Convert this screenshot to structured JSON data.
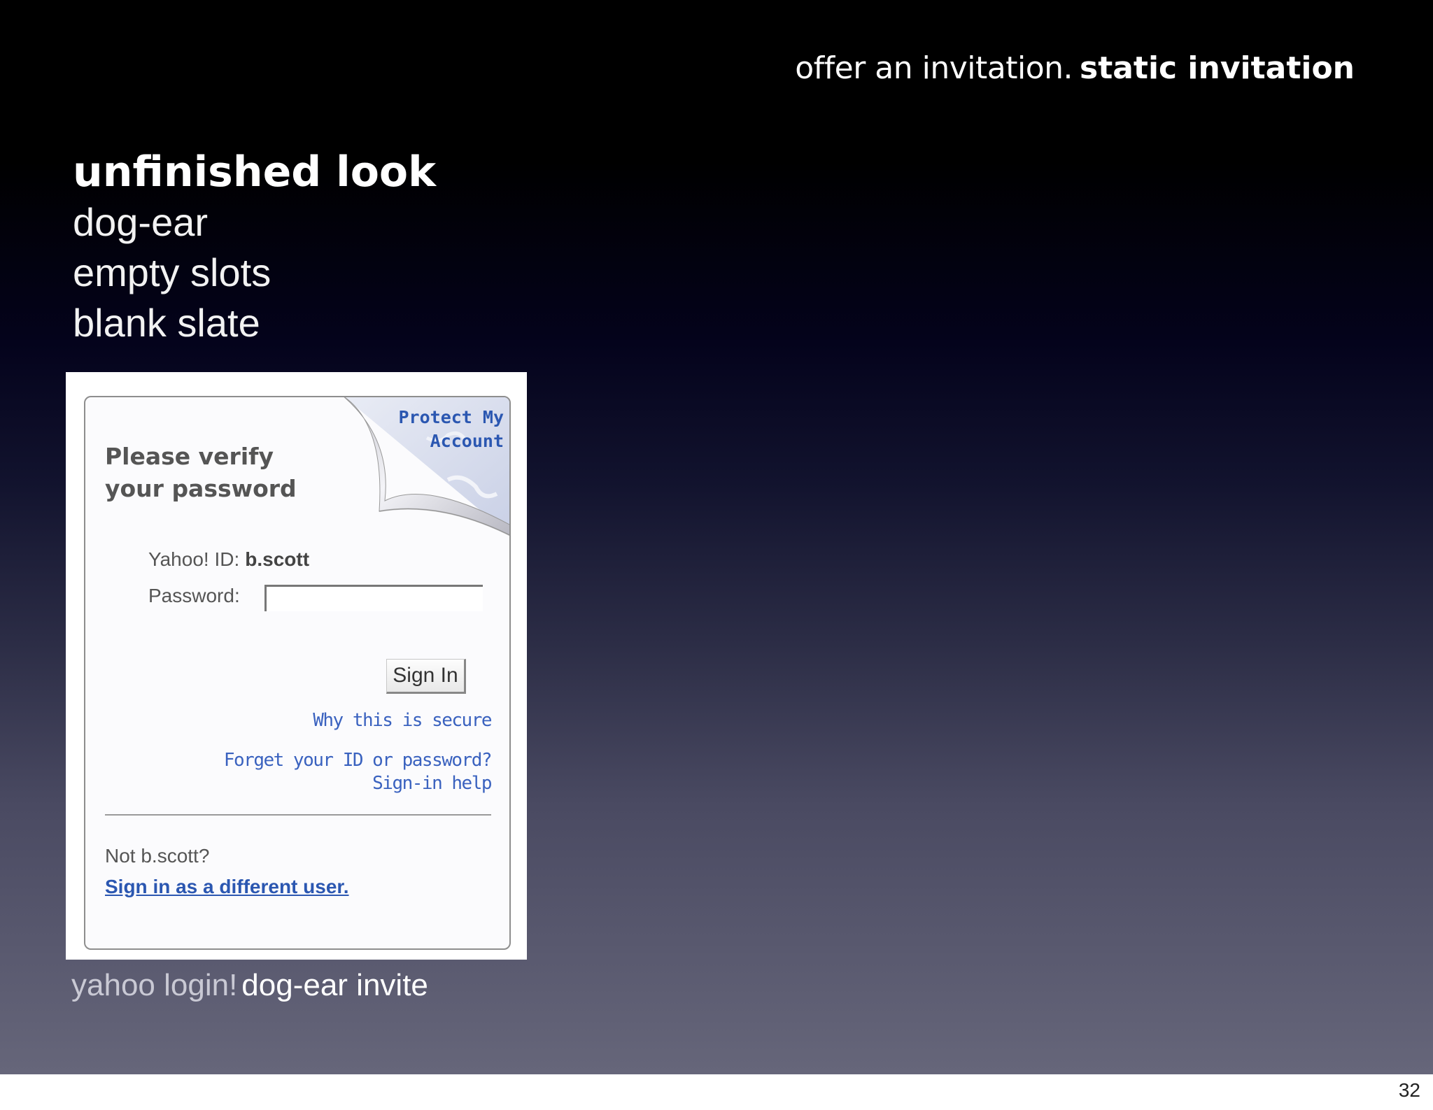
{
  "slide": {
    "header": {
      "light": "offer an invitation.",
      "bold": "static invitation"
    },
    "heading": "unfinished look",
    "bullets": [
      "dog-ear",
      "empty slots",
      "blank slate"
    ],
    "caption": {
      "light": "yahoo login!",
      "strong": "dog-ear invite"
    },
    "page_number": "32"
  },
  "login": {
    "dogear_link": {
      "line1": "Protect My",
      "line2": "Account"
    },
    "title": {
      "line1": "Please verify",
      "line2": "your password"
    },
    "id_label": "Yahoo! ID:",
    "id_value": "b.scott",
    "password_label": "Password:",
    "password_value": "",
    "sign_in_label": "Sign In",
    "why_secure": "Why this is secure",
    "forget": "Forget your ID or password?",
    "help": "Sign-in help",
    "not_user": "Not b.scott?",
    "different_user": "Sign in as a different user."
  }
}
